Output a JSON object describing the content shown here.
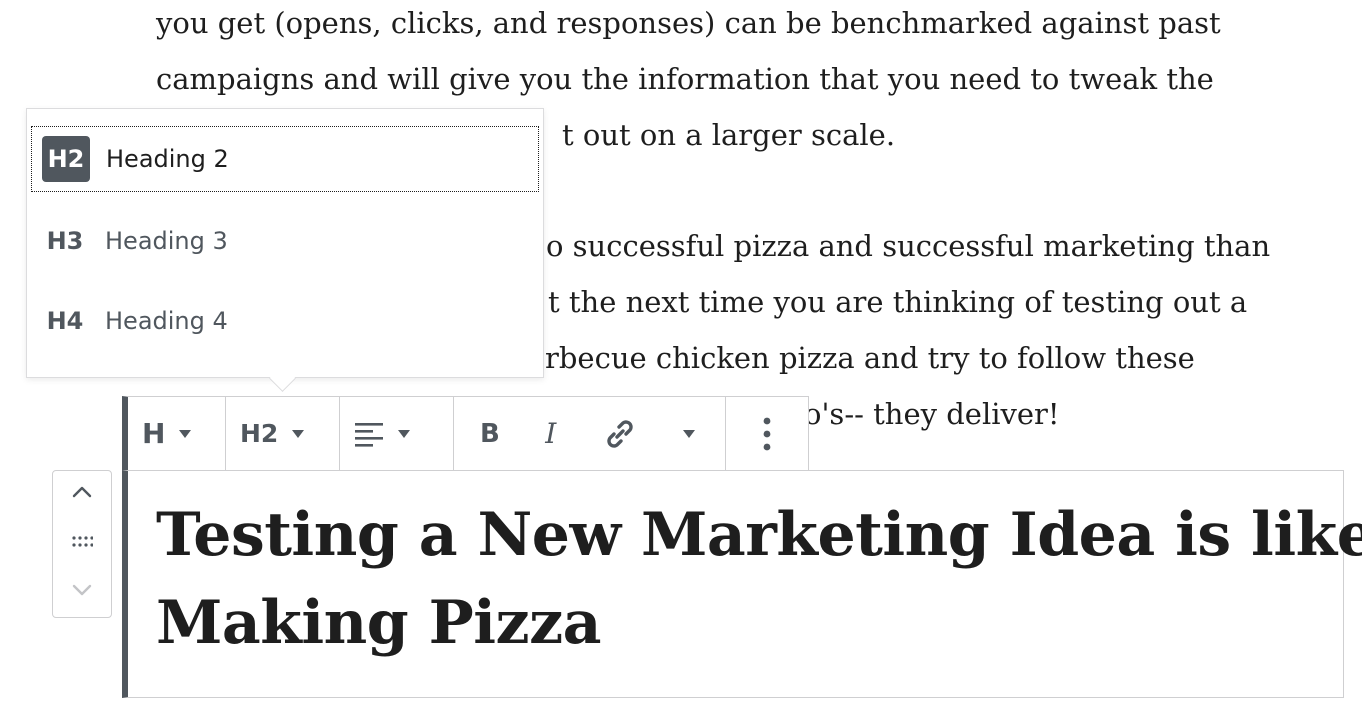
{
  "paragraph_1": {
    "lines": [
      "you get (opens, clicks, and responses) can be benchmarked against past",
      "campaigns and will give you the information that you need to tweak the",
      "t out on a larger scale."
    ]
  },
  "paragraph_2": {
    "lines": [
      "o successful pizza and successful marketing than",
      "t the next time you are thinking of testing out a",
      "rbecue chicken pizza and try to follow these",
      "o's-- they deliver!"
    ]
  },
  "heading_dropdown": {
    "items": [
      {
        "badge": "H2",
        "label": "Heading 2",
        "active": true
      },
      {
        "badge": "H3",
        "label": "Heading 3",
        "active": false
      },
      {
        "badge": "H4",
        "label": "Heading 4",
        "active": false
      }
    ]
  },
  "toolbar": {
    "block_type_label": "H",
    "heading_level_label": "H2",
    "bold_label": "B",
    "italic_label": "I",
    "icons": {
      "align": "align-left-icon",
      "link": "link-icon",
      "more": "more-vertical-icon"
    }
  },
  "mover": {
    "icons": {
      "up": "chevron-up-icon",
      "drag": "drag-handle-icon",
      "down": "chevron-down-icon"
    }
  },
  "heading_block": {
    "lines": [
      "Testing a New Marketing Idea is like",
      "Making Pizza"
    ]
  },
  "colors": {
    "accent": "#50575e",
    "text": "#1e1e1e",
    "border": "#cfcfd1"
  }
}
